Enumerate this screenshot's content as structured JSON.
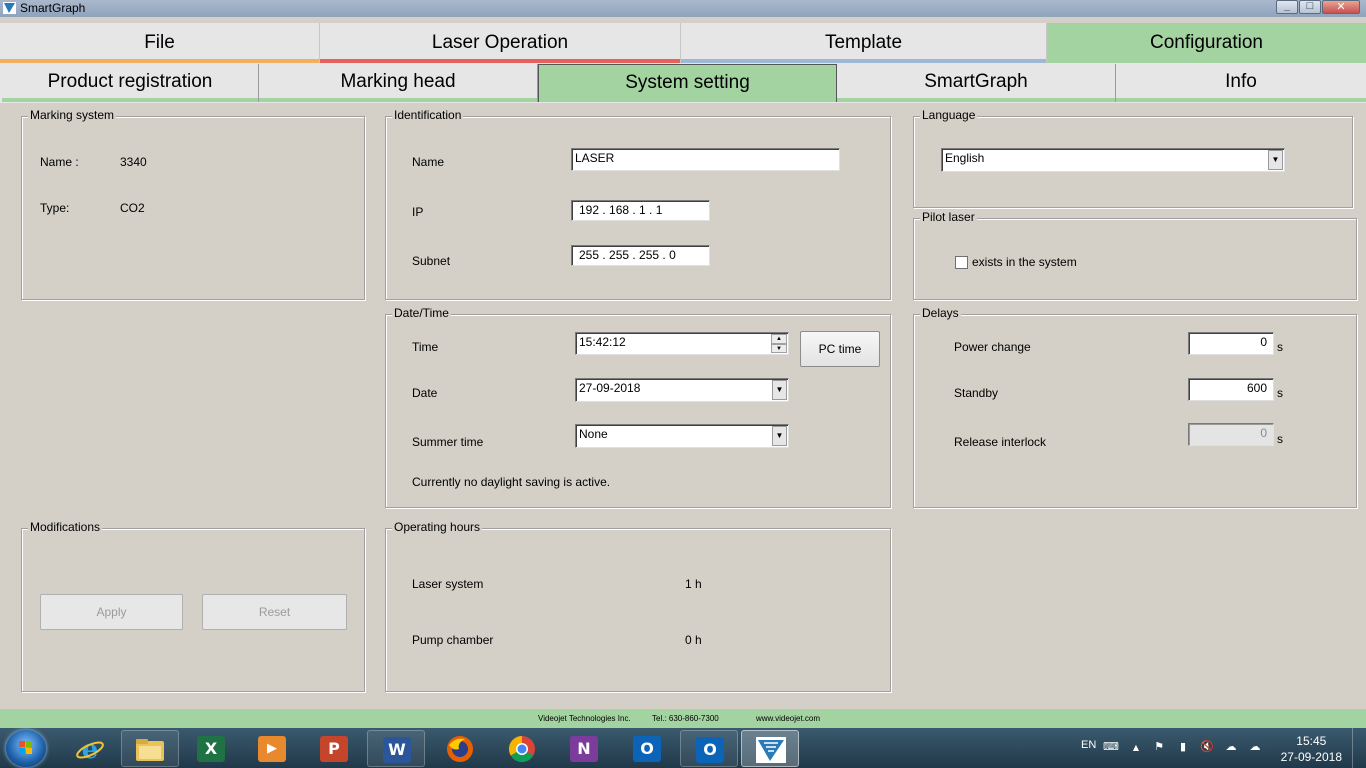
{
  "window": {
    "title": "SmartGraph"
  },
  "main_tabs": [
    {
      "label": "File",
      "bar_color": "#f0b060"
    },
    {
      "label": "Laser Operation",
      "bar_color": "#e8605a"
    },
    {
      "label": "Template",
      "bar_color": "#9fb8d8"
    },
    {
      "label": "Configuration",
      "active": true
    }
  ],
  "sub_tabs": [
    {
      "label": "Product registration"
    },
    {
      "label": "Marking head"
    },
    {
      "label": "System setting",
      "active": true
    },
    {
      "label": "SmartGraph"
    },
    {
      "label": "Info"
    }
  ],
  "marking_system": {
    "legend": "Marking system",
    "name_label": "Name :",
    "name_value": "3340",
    "type_label": "Type:",
    "type_value": "CO2"
  },
  "identification": {
    "legend": "Identification",
    "name_label": "Name",
    "name_value": "LASER",
    "ip_label": "IP",
    "ip_value": "192 . 168 .  1   .  1",
    "subnet_label": "Subnet",
    "subnet_value": "255 . 255 . 255 .  0"
  },
  "language": {
    "legend": "Language",
    "selected": "English"
  },
  "pilot_laser": {
    "legend": "Pilot laser",
    "checkbox_label": "exists in the system",
    "checked": false
  },
  "datetime": {
    "legend": "Date/Time",
    "time_label": "Time",
    "time_value": "15:42:12",
    "pc_time_button": "PC time",
    "date_label": "Date",
    "date_value": "27-09-2018",
    "summer_label": "Summer time",
    "summer_value": "None",
    "status_text": "Currently no daylight saving is active."
  },
  "delays": {
    "legend": "Delays",
    "power_change_label": "Power change",
    "power_change_value": "0",
    "standby_label": "Standby",
    "standby_value": "600",
    "release_label": "Release interlock",
    "release_value": "0",
    "unit": "s"
  },
  "modifications": {
    "legend": "Modifications",
    "apply_label": "Apply",
    "reset_label": "Reset"
  },
  "operating_hours": {
    "legend": "Operating hours",
    "laser_label": "Laser system",
    "laser_value": "1 h",
    "pump_label": "Pump chamber",
    "pump_value": "0 h"
  },
  "footer": {
    "company": "Videojet Technologies Inc.",
    "phone": "Tel.: 630-860-7300",
    "website": "www.videojet.com"
  },
  "taskbar": {
    "apps": [
      {
        "icon": "internet-explorer-icon"
      },
      {
        "icon": "file-explorer-icon"
      },
      {
        "icon": "excel-icon",
        "glyph": "X",
        "color": "#1f7244"
      },
      {
        "icon": "media-player-icon",
        "glyph": "▶",
        "color": "#e8892e"
      },
      {
        "icon": "powerpoint-icon",
        "glyph": "P",
        "color": "#c5452a"
      },
      {
        "icon": "word-icon",
        "glyph": "W",
        "color": "#2b579a"
      },
      {
        "icon": "firefox-icon"
      },
      {
        "icon": "chrome-icon"
      },
      {
        "icon": "onenote-icon",
        "glyph": "N",
        "color": "#7b3c9c"
      },
      {
        "icon": "outlook-icon",
        "glyph": "O",
        "color": "#0b64b7"
      },
      {
        "icon": "outlook-mail-icon",
        "glyph": "O",
        "color": "#0b64b7"
      },
      {
        "icon": "smartgraph-icon"
      }
    ],
    "language": "EN",
    "time": "15:45",
    "date": "27-09-2018"
  }
}
